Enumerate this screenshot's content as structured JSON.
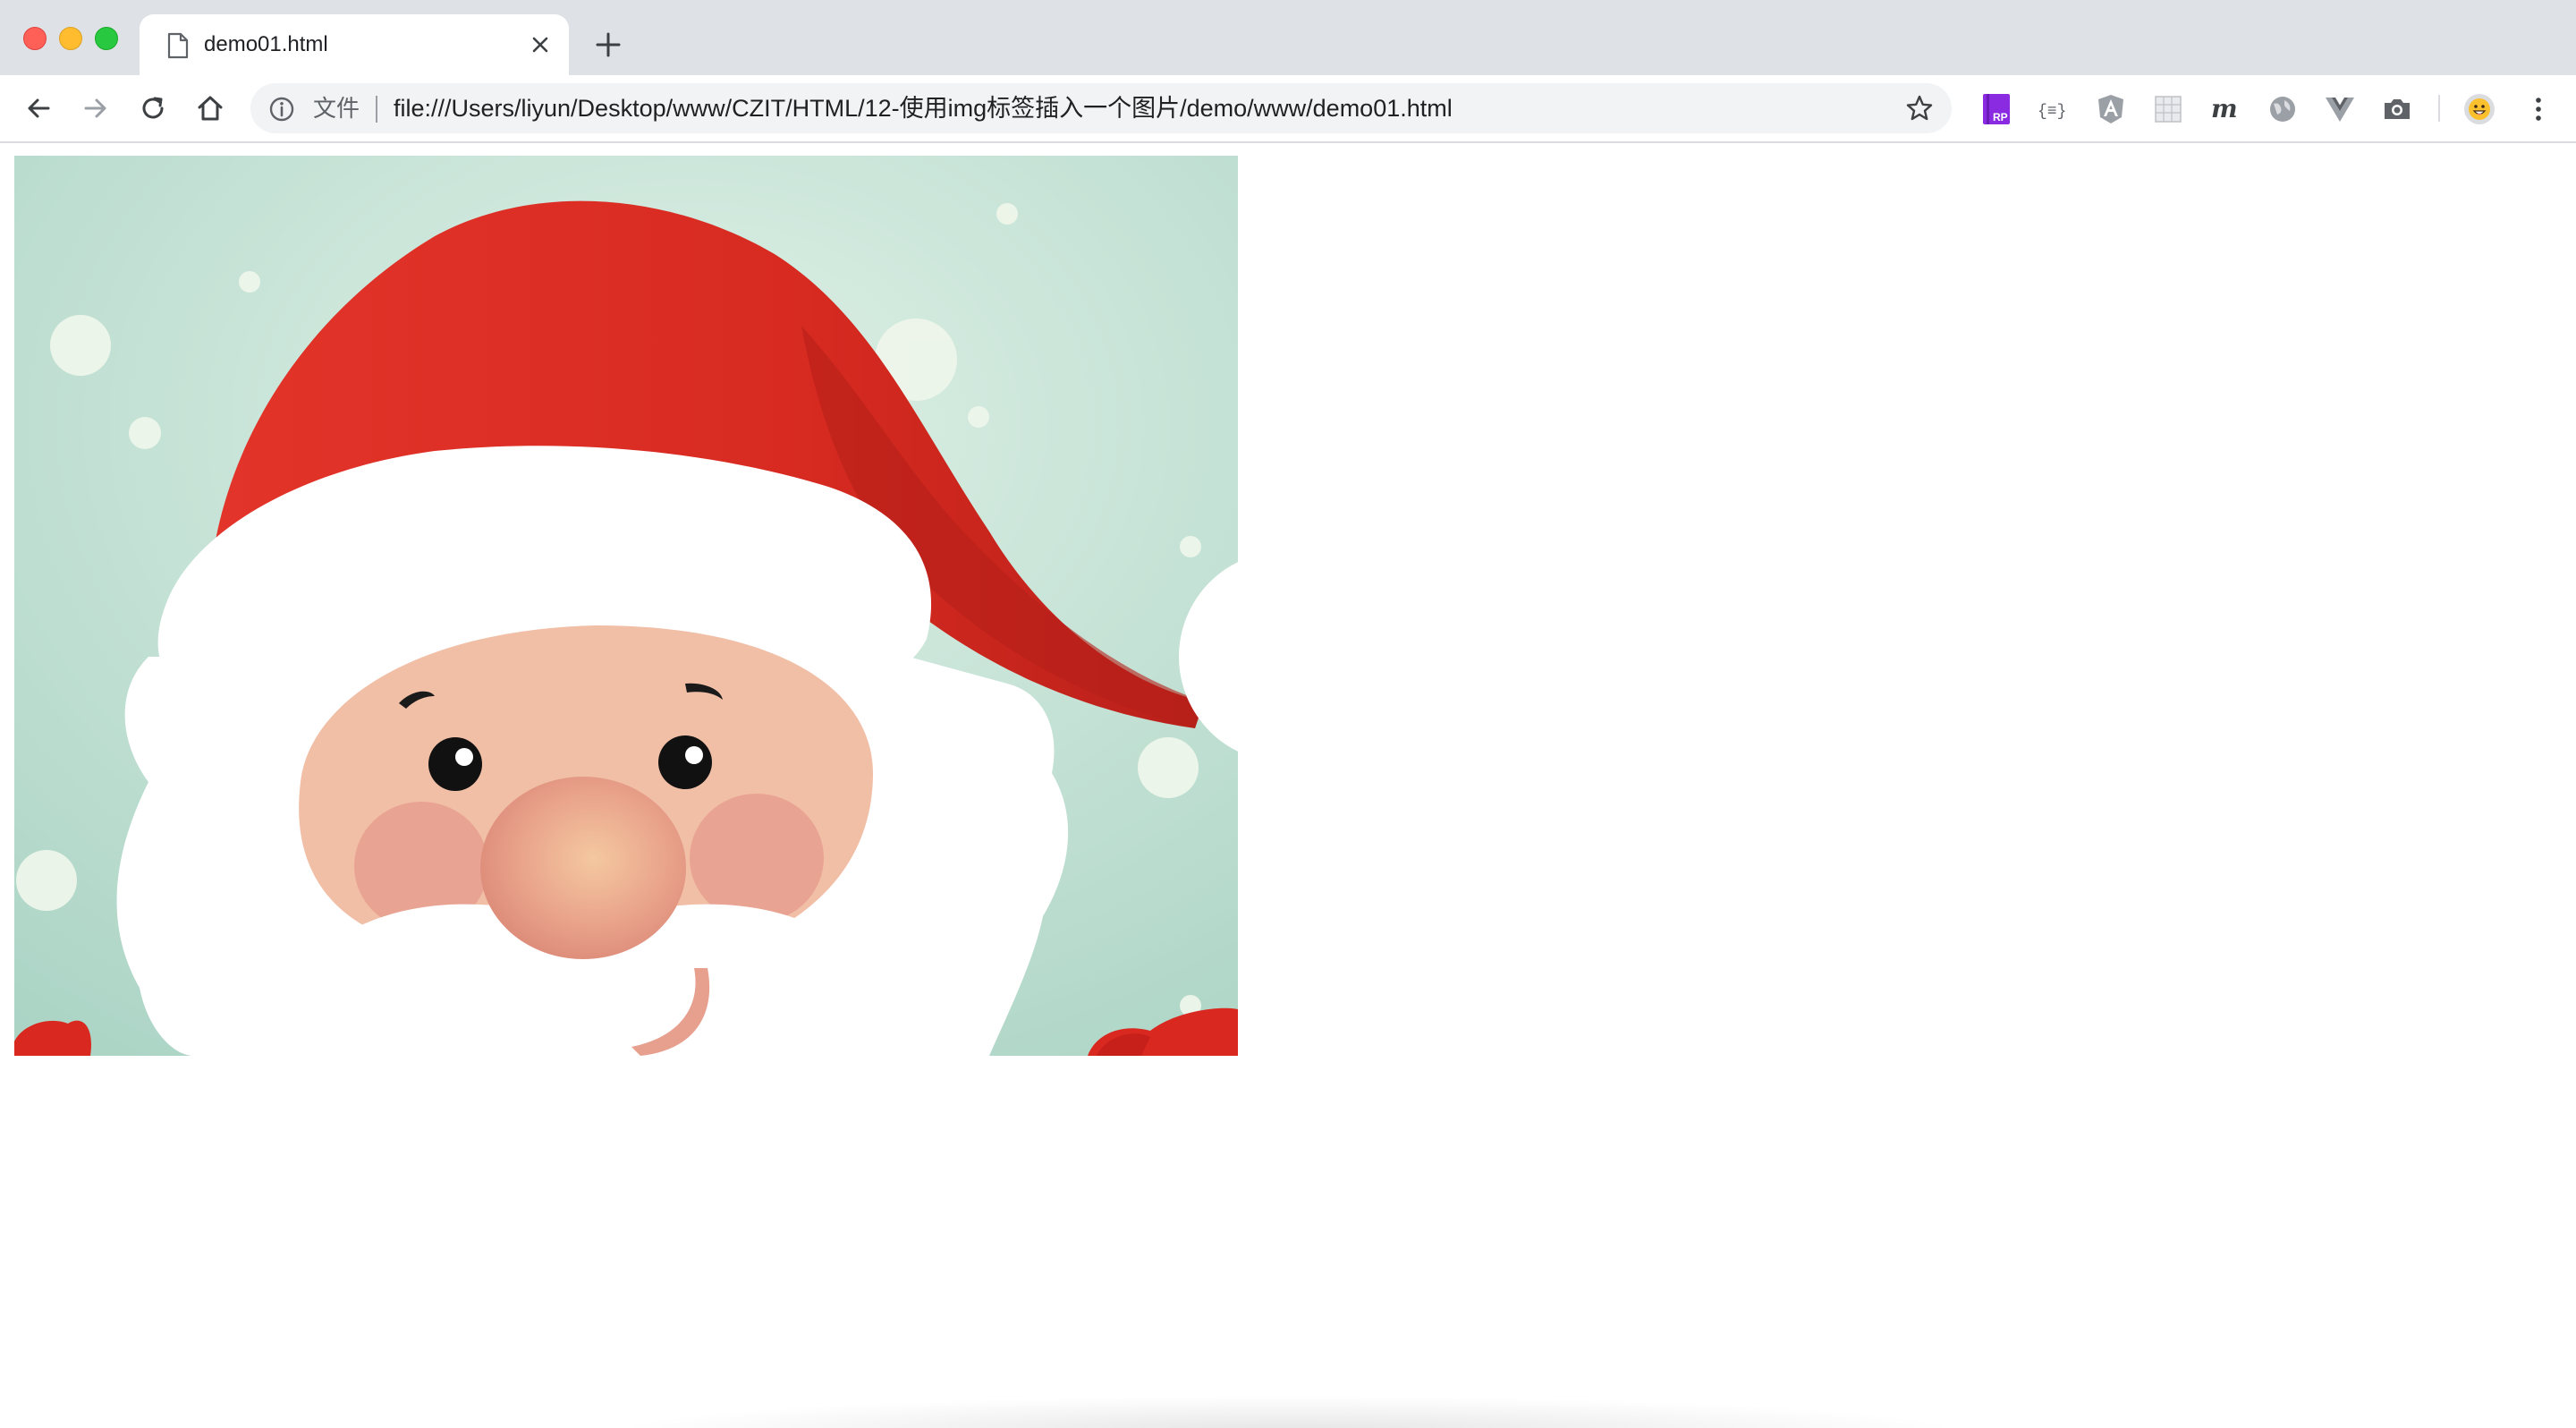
{
  "browser": {
    "tab": {
      "title": "demo01.html",
      "page_icon": "page-icon",
      "close_icon": "close-icon"
    },
    "new_tab_icon": "plus-icon",
    "toolbar": {
      "back_icon": "arrow-left-icon",
      "forward_icon": "arrow-right-icon",
      "reload_icon": "reload-icon",
      "home_icon": "home-icon",
      "menu_icon": "kebab-menu-icon"
    },
    "omnibox": {
      "info_icon": "info-icon",
      "security_label": "文件",
      "url": "file:///Users/liyun/Desktop/www/CZIT/HTML/12-使用img标签插入一个图片/demo/www/demo01.html",
      "bookmark_icon": "star-icon"
    },
    "extensions": [
      "axure-rp-extension-icon",
      "json-formatter-extension-icon",
      "angular-extension-icon",
      "grid-extension-icon",
      "m-extension-icon",
      "globe-extension-icon",
      "vue-extension-icon",
      "camera-extension-icon",
      "profile-avatar-icon"
    ]
  },
  "page": {
    "image": {
      "subject": "santa-claus-image"
    }
  },
  "colors": {
    "tabstrip_bg": "#dee1e6",
    "omnibox_bg": "#f1f3f4",
    "santa_red": "#d9281f",
    "santa_bg": "#c9e4d9",
    "skin": "#f1bea6"
  }
}
